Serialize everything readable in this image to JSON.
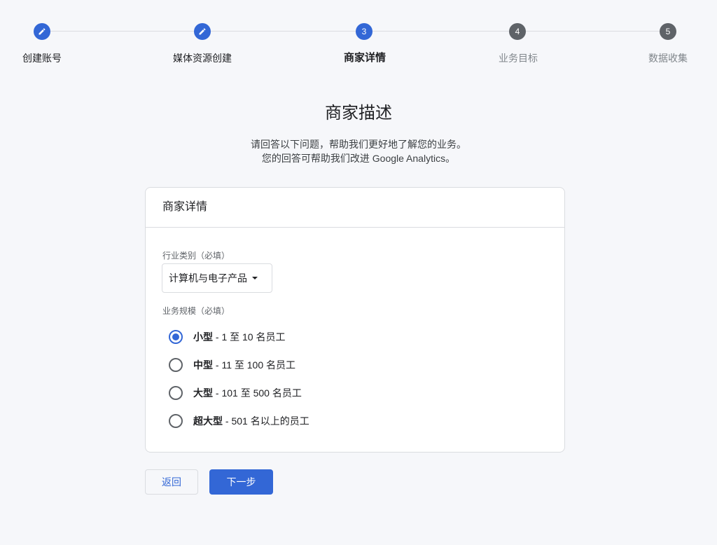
{
  "colors": {
    "primary": "#3367d6",
    "step_pending": "#5f6368",
    "background": "#f6f7fa"
  },
  "stepper": {
    "steps": [
      {
        "label": "创建账号",
        "status": "completed",
        "icon": "edit-pencil-icon"
      },
      {
        "label": "媒体资源创建",
        "status": "completed",
        "icon": "edit-pencil-icon"
      },
      {
        "label": "商家详情",
        "status": "active",
        "number": "3"
      },
      {
        "label": "业务目标",
        "status": "pending",
        "number": "4"
      },
      {
        "label": "数据收集",
        "status": "pending",
        "number": "5"
      }
    ]
  },
  "page": {
    "heading": "商家描述",
    "subtitle_line1": "请回答以下问题，帮助我们更好地了解您的业务。",
    "subtitle_line2": "您的回答可帮助我们改进 Google Analytics。"
  },
  "card": {
    "title": "商家详情",
    "industry": {
      "label": "行业类别（必填）",
      "selected": "计算机与电子产品"
    },
    "size": {
      "label": "业务规模（必填）",
      "selected_index": 0,
      "options": [
        {
          "name": "小型",
          "detail": " - 1 至 10 名员工"
        },
        {
          "name": "中型",
          "detail": " - 11 至 100 名员工"
        },
        {
          "name": "大型",
          "detail": " - 101 至 500 名员工"
        },
        {
          "name": "超大型",
          "detail": " - 501 名以上的员工"
        }
      ]
    }
  },
  "buttons": {
    "back": "返回",
    "next": "下一步"
  }
}
